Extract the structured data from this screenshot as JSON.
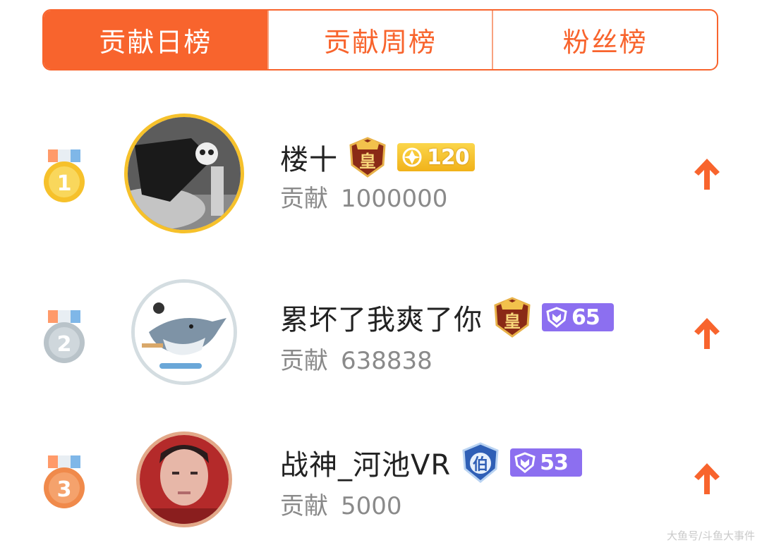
{
  "tabs": [
    {
      "label": "贡献日榜",
      "active": true
    },
    {
      "label": "贡献周榜",
      "active": false
    },
    {
      "label": "粉丝榜",
      "active": false
    }
  ],
  "colors": {
    "accent": "#f8642d",
    "gold": "#f6c12b",
    "silver": "#b9c3c9",
    "bronze": "#f08a4b",
    "level_gold": "#f6c32a",
    "level_purple": "#8c6ff0"
  },
  "contribution_label": "贡献",
  "ranks": [
    {
      "rank": "1",
      "medal": "gold",
      "name": "楼十",
      "crown_badge": "皇",
      "level_badge": {
        "value": "120",
        "style": "gold",
        "icon": "crest-icon"
      },
      "contribution": "1000000",
      "trend_icon": "arrow-up-icon"
    },
    {
      "rank": "2",
      "medal": "silver",
      "name": "累坏了我爽了你",
      "crown_badge": "皇",
      "level_badge": {
        "value": "65",
        "style": "purple",
        "icon": "shield-icon"
      },
      "contribution": "638838",
      "trend_icon": "arrow-up-icon"
    },
    {
      "rank": "3",
      "medal": "bronze",
      "name": "战神_河池VR",
      "crown_badge": "伯",
      "level_badge": {
        "value": "53",
        "style": "purple",
        "icon": "shield-icon"
      },
      "contribution": "5000",
      "trend_icon": "arrow-up-icon"
    }
  ],
  "watermark": "大鱼号/斗鱼大事件"
}
